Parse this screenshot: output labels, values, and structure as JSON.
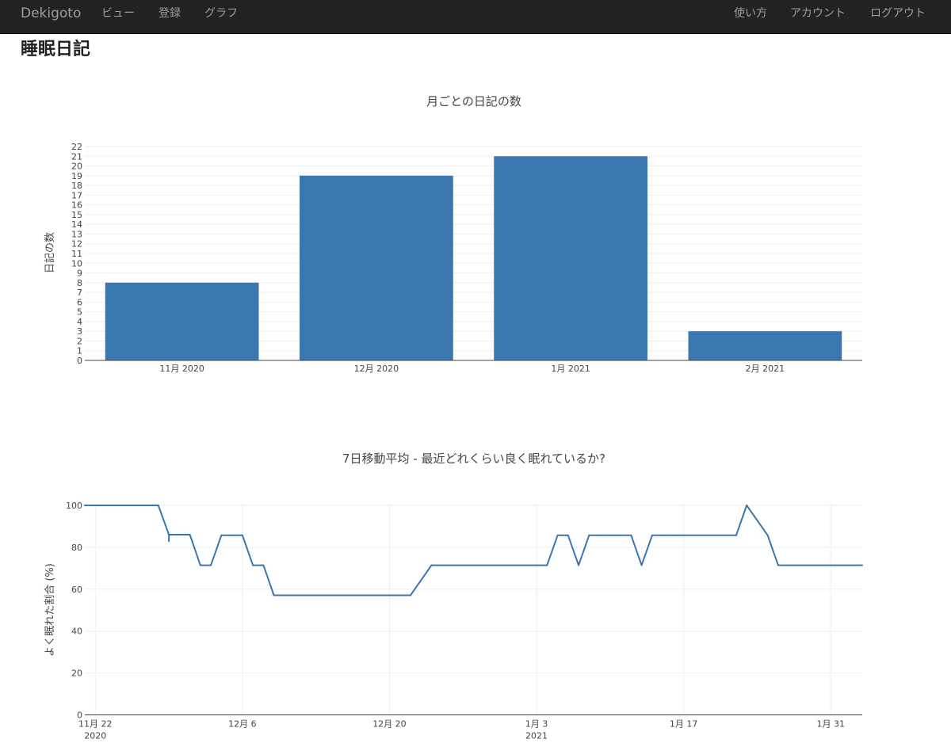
{
  "nav": {
    "brand": "Dekigoto",
    "items": [
      "ビュー",
      "登録",
      "グラフ"
    ],
    "right_items": [
      "使い方",
      "アカウント",
      "ログアウト"
    ]
  },
  "page": {
    "title": "睡眠日記"
  },
  "colors": {
    "navbar": "#222222",
    "series": "#3a76af",
    "grid": "#eeeeee"
  },
  "chart_data": [
    {
      "type": "bar",
      "title": "月ごとの日記の数",
      "xlabel": "",
      "ylabel": "日記の数",
      "categories": [
        "11月 2020",
        "12月 2020",
        "1月 2021",
        "2月 2021"
      ],
      "values": [
        8,
        19,
        21,
        3
      ],
      "ylim": [
        0,
        22
      ],
      "yticks": [
        0,
        1,
        2,
        3,
        4,
        5,
        6,
        7,
        8,
        9,
        10,
        11,
        12,
        13,
        14,
        15,
        16,
        17,
        18,
        19,
        20,
        21,
        22
      ],
      "grid": true,
      "legend": "none"
    },
    {
      "type": "line",
      "title": "7日移動平均 - 最近どれくらい良く眠れているか?",
      "xlabel": "",
      "ylabel": "よく眠れた割合 (%)",
      "ylim": [
        0,
        100
      ],
      "yticks": [
        0,
        20,
        40,
        60,
        80,
        100
      ],
      "xlim": [
        "2020-11-21",
        "2021-02-03"
      ],
      "xticks": [
        {
          "date": "2020-11-22",
          "label": "11月 22",
          "sublabel": "2020"
        },
        {
          "date": "2020-12-06",
          "label": "12月 6",
          "sublabel": ""
        },
        {
          "date": "2020-12-20",
          "label": "12月 20",
          "sublabel": ""
        },
        {
          "date": "2021-01-03",
          "label": "1月 3",
          "sublabel": "2021"
        },
        {
          "date": "2021-01-17",
          "label": "1月 17",
          "sublabel": ""
        },
        {
          "date": "2021-01-31",
          "label": "1月 31",
          "sublabel": ""
        }
      ],
      "grid": true,
      "legend": "none",
      "series": [
        {
          "x": [
            "2020-11-21",
            "2020-11-28",
            "2020-11-29",
            "2020-11-29",
            "2020-11-29",
            "2020-12-01",
            "2020-12-02",
            "2020-12-03",
            "2020-12-04",
            "2020-12-05",
            "2020-12-06",
            "2020-12-07",
            "2020-12-08",
            "2020-12-09",
            "2020-12-10",
            "2020-12-11",
            "2020-12-22",
            "2020-12-24",
            "2021-01-04",
            "2021-01-05",
            "2021-01-06",
            "2021-01-07",
            "2021-01-08",
            "2021-01-09",
            "2021-01-10",
            "2021-01-11",
            "2021-01-12",
            "2021-01-13",
            "2021-01-14",
            "2021-01-15",
            "2021-01-16",
            "2021-01-22",
            "2021-01-23",
            "2021-01-25",
            "2021-01-26",
            "2021-02-03"
          ],
          "y": [
            100,
            100,
            86,
            83,
            86,
            86,
            71.4,
            71.4,
            85.7,
            85.7,
            85.7,
            71.4,
            71.4,
            57.1,
            57.1,
            57.1,
            57.1,
            71.4,
            71.4,
            85.7,
            85.7,
            71.4,
            85.7,
            85.7,
            85.7,
            85.7,
            85.7,
            71.4,
            85.7,
            85.7,
            85.7,
            85.7,
            100,
            85.7,
            71.4,
            71.4
          ]
        }
      ]
    }
  ]
}
